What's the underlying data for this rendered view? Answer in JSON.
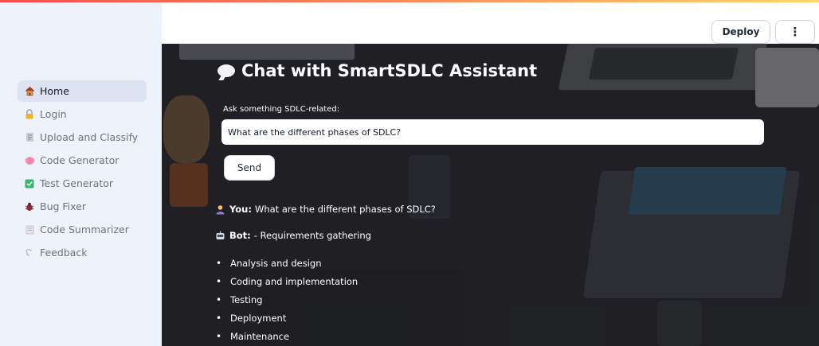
{
  "sidebar": {
    "items": [
      {
        "label": "Home",
        "icon": "home-icon",
        "active": true
      },
      {
        "label": "Login",
        "icon": "lock-icon",
        "active": false
      },
      {
        "label": "Upload and Classify",
        "icon": "document-icon",
        "active": false
      },
      {
        "label": "Code Generator",
        "icon": "brain-icon",
        "active": false
      },
      {
        "label": "Test Generator",
        "icon": "checkbox-icon",
        "active": false
      },
      {
        "label": "Bug Fixer",
        "icon": "bug-icon",
        "active": false
      },
      {
        "label": "Code Summarizer",
        "icon": "summary-icon",
        "active": false
      },
      {
        "label": "Feedback",
        "icon": "feedback-icon",
        "active": false
      }
    ]
  },
  "header": {
    "deploy_label": "Deploy",
    "menu_label": "⋮"
  },
  "main": {
    "title": "Chat with SmartSDLC Assistant",
    "input_label": "Ask something SDLC-related:",
    "input_value": "What are the different phases of SDLC?",
    "send_label": "Send",
    "chat": {
      "you_label": "You:",
      "you_message": "What are the different phases of SDLC?",
      "bot_label": "Bot:",
      "bot_first": "- Requirements gathering",
      "bot_list": [
        "Analysis and design",
        "Coding and implementation",
        "Testing",
        "Deployment",
        "Maintenance"
      ]
    }
  },
  "colors": {
    "accent_red": "#ff4b4b",
    "sidebar_bg": "#eef2fb",
    "active_item_bg": "#dde4f1"
  }
}
